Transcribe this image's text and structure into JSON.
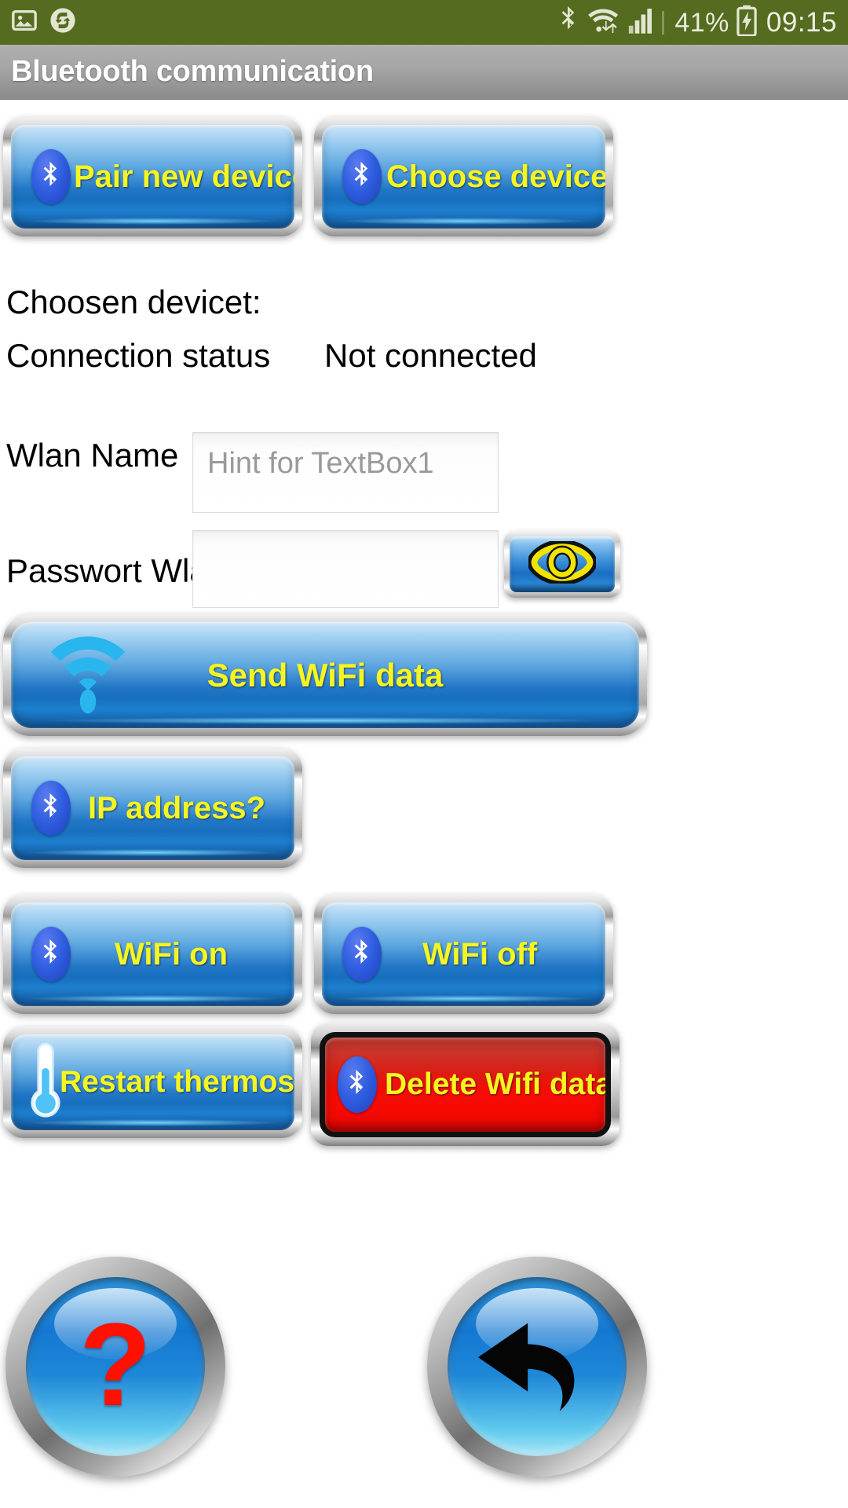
{
  "status_bar": {
    "background_color": "#556b1f",
    "left_icons": [
      "image-icon",
      "sync-icon"
    ],
    "right_icons": [
      "bluetooth-icon",
      "wifi-icon",
      "cellular-signal-icon",
      "battery-charging-icon"
    ],
    "battery_percent": "41%",
    "clock": "09:15"
  },
  "title_bar": {
    "title": "Bluetooth communication"
  },
  "colors": {
    "button_label": "#f5f522",
    "button_blue": "#1f7ac8",
    "danger_red": "#f40d05",
    "status_green": "#556b1f"
  },
  "actions": {
    "pair_new_device": "Pair new device",
    "choose_device": "Choose device",
    "send_wifi_data": "Send WiFi data",
    "ip_address": "IP address?",
    "wifi_on": "WiFi on",
    "wifi_off": "WiFi off",
    "restart_thermostat": "Restart thermostat",
    "delete_wifi_data": "Delete Wifi data"
  },
  "info": {
    "chosen_device_label": "Choosen devicet:",
    "chosen_device_value": "",
    "connection_status_label": "Connection status",
    "connection_status_value": "Not connected"
  },
  "form": {
    "wlan_name_label": "Wlan Name",
    "wlan_name_value": "",
    "wlan_name_placeholder": "Hint for TextBox1",
    "wlan_password_label": "Passwort Wlan",
    "wlan_password_value": "",
    "wlan_password_placeholder": ""
  },
  "footer": {
    "help_button": "?",
    "back_button": "back-arrow"
  }
}
